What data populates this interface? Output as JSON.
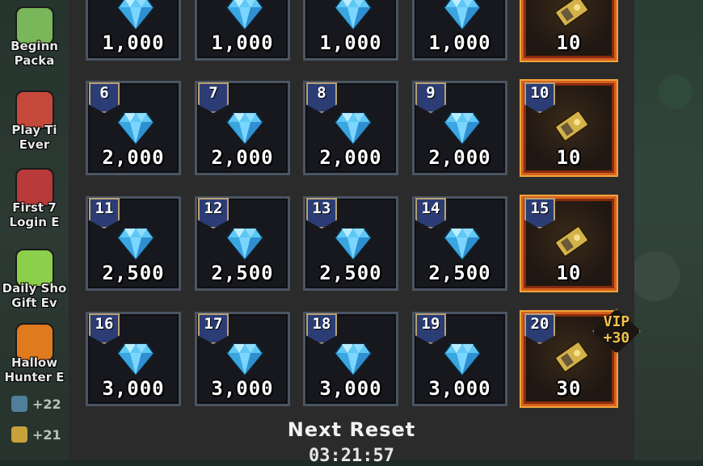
{
  "side_events": [
    {
      "label": "Beginn\nPacka",
      "icon": "sprout-icon",
      "color": "#7ab65a"
    },
    {
      "label": "Play Ti\nEver",
      "icon": "clock-icon",
      "color": "#c5493a"
    },
    {
      "label": "First 7\nLogin E",
      "icon": "calendar-icon",
      "color": "#b83a3a"
    },
    {
      "label": "Daily Sho\nGift Ev",
      "icon": "slime-icon",
      "color": "#8ccf4a"
    },
    {
      "label": "Hallow\nHunter E",
      "icon": "pumpkin-icon",
      "color": "#e07a1f"
    }
  ],
  "resources": [
    {
      "icon": "exp-icon",
      "value": "+22",
      "color": "#4f7f9a"
    },
    {
      "icon": "coin-icon",
      "value": "+21",
      "color": "#c7a23a"
    }
  ],
  "rewards": [
    {
      "day": "",
      "amount": "1,000",
      "type": "diamond"
    },
    {
      "day": "",
      "amount": "1,000",
      "type": "diamond"
    },
    {
      "day": "",
      "amount": "1,000",
      "type": "diamond"
    },
    {
      "day": "",
      "amount": "1,000",
      "type": "diamond"
    },
    {
      "day": "",
      "amount": "10",
      "type": "ticket"
    },
    {
      "day": "6",
      "amount": "2,000",
      "type": "diamond"
    },
    {
      "day": "7",
      "amount": "2,000",
      "type": "diamond"
    },
    {
      "day": "8",
      "amount": "2,000",
      "type": "diamond"
    },
    {
      "day": "9",
      "amount": "2,000",
      "type": "diamond"
    },
    {
      "day": "10",
      "amount": "10",
      "type": "ticket"
    },
    {
      "day": "11",
      "amount": "2,500",
      "type": "diamond"
    },
    {
      "day": "12",
      "amount": "2,500",
      "type": "diamond"
    },
    {
      "day": "13",
      "amount": "2,500",
      "type": "diamond"
    },
    {
      "day": "14",
      "amount": "2,500",
      "type": "diamond"
    },
    {
      "day": "15",
      "amount": "10",
      "type": "ticket"
    },
    {
      "day": "16",
      "amount": "3,000",
      "type": "diamond"
    },
    {
      "day": "17",
      "amount": "3,000",
      "type": "diamond"
    },
    {
      "day": "18",
      "amount": "3,000",
      "type": "diamond"
    },
    {
      "day": "19",
      "amount": "3,000",
      "type": "diamond"
    },
    {
      "day": "20",
      "amount": "30",
      "type": "ticket"
    }
  ],
  "vip_badge": {
    "line1": "VIP",
    "line2": "+30"
  },
  "reset": {
    "title": "Next Reset",
    "time": "03:21:57"
  },
  "colors": {
    "diamond": "#5fc8f5",
    "ticket": "#d4b24a",
    "special_border": "#d6601f",
    "badge": "#2c3d75"
  }
}
